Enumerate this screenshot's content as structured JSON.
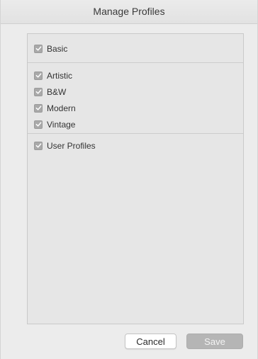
{
  "window": {
    "title": "Manage Profiles"
  },
  "groups": [
    {
      "items": [
        {
          "label": "Basic",
          "checked": true
        }
      ]
    },
    {
      "items": [
        {
          "label": "Artistic",
          "checked": true
        },
        {
          "label": "B&W",
          "checked": true
        },
        {
          "label": "Modern",
          "checked": true
        },
        {
          "label": "Vintage",
          "checked": true
        }
      ]
    },
    {
      "items": [
        {
          "label": "User Profiles",
          "checked": true
        }
      ]
    }
  ],
  "buttons": {
    "cancel_label": "Cancel",
    "save_label": "Save",
    "save_enabled": false
  },
  "colors": {
    "checkbox_checked": "#a9a9a9",
    "save_disabled": "#b5b5b5"
  },
  "icons": {
    "checkbox": "checkmark-icon"
  }
}
